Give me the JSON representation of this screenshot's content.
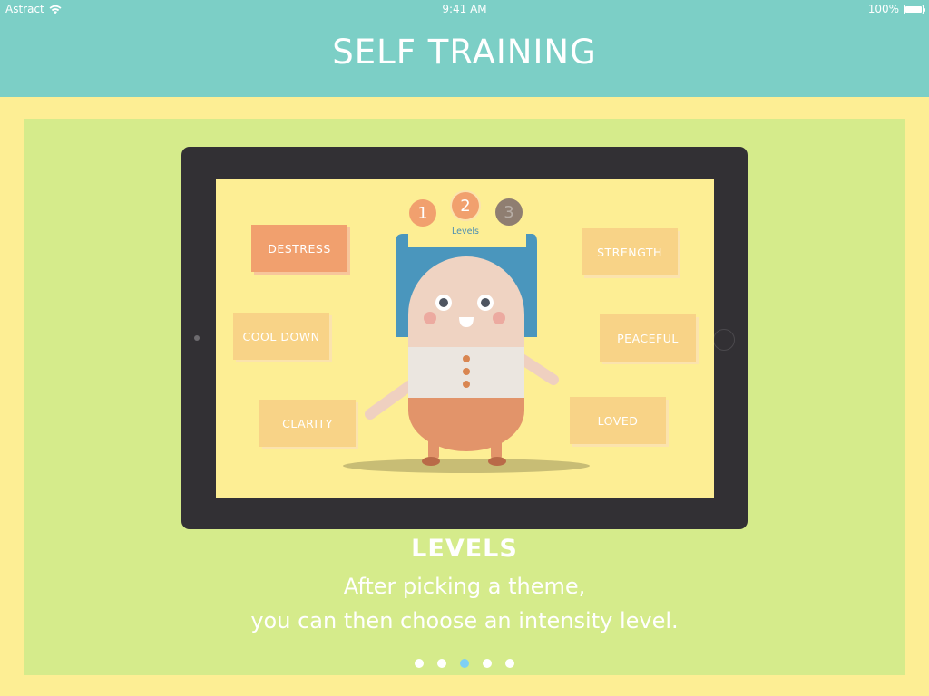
{
  "status_bar": {
    "carrier": "Astract",
    "time": "9:41 AM",
    "battery": "100%"
  },
  "header": {
    "title": "SELF TRAINING"
  },
  "screen": {
    "themes": {
      "destress": "DESTRESS",
      "cool_down": "COOL DOWN",
      "clarity": "CLARITY",
      "strength": "STRENGTH",
      "peaceful": "PEACEFUL",
      "loved": "LOVED"
    },
    "active_theme": "DESTRESS",
    "levels": {
      "label": "Levels",
      "items": [
        "1",
        "2",
        "3"
      ],
      "selected": "2"
    }
  },
  "caption": {
    "title": "LEVELS",
    "body": "After picking a theme,\nyou can then choose an intensity level."
  },
  "pagination": {
    "total": 5,
    "current": 3
  },
  "colors": {
    "header": "#7ccfc6",
    "background": "#fdee94",
    "card": "#d5eb8b",
    "active_dot": "#7ed0f4",
    "theme_active": "#f1a06e",
    "theme": "#f8d387"
  }
}
